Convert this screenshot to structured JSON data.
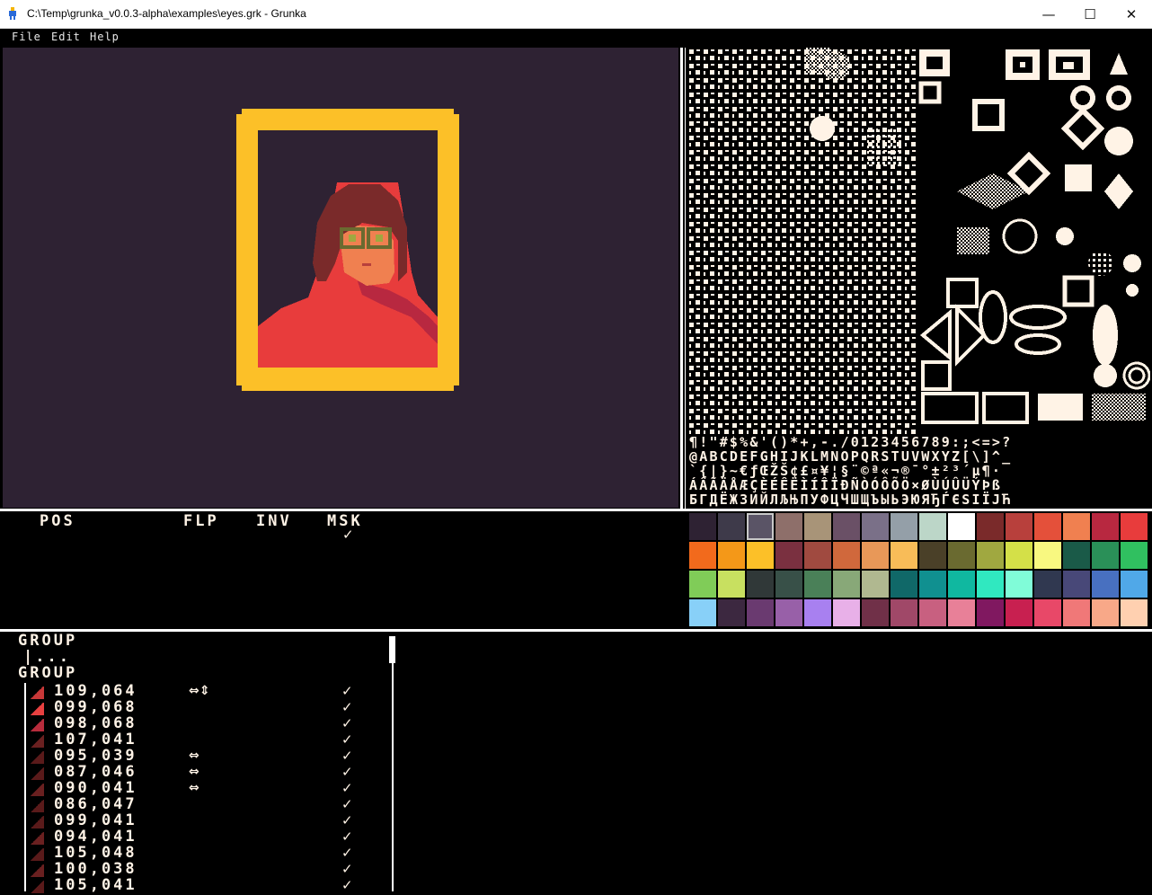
{
  "window": {
    "title": "C:\\Temp\\grunka_v0.0.3-alpha\\examples\\eyes.grk - Grunka",
    "minimize": "—",
    "maximize": "☐",
    "close": "✕"
  },
  "menu": [
    "File",
    "Edit",
    "Help"
  ],
  "glyphsheet": {
    "row1": "¶!\"#$%&'()*+,-./0123456789:;<=>?",
    "row2": "@ABCDEFGHIJKLMNOPQRSTUVWXYZ[\\]^_",
    "row3": "`{|}~€ƒŒŽŠ¢£¤¥¦§¨©ª«¬®¯°±²³´µ¶·",
    "row4": "ÁÂÃÄÅÆÇÈÉÊËÌÍÎÏÐÑÒÓÔÕÖ×ØÙÚÛÜÝÞß",
    "row5": "БГДЁЖЗИЙЛЉЊПУФЦЧШЩЪЫЬЭЮЯЂЃЄЅІЇЈЋ"
  },
  "properties": {
    "headers": {
      "pos": "POS",
      "flp": "FLP",
      "inv": "INV",
      "msk": "MSK"
    },
    "msk_value": "✓"
  },
  "palette": {
    "selected_index": 2,
    "colors": [
      "#2e2233",
      "#3e3a4a",
      "#5a5466",
      "#8e6f6a",
      "#a89478",
      "#6a5066",
      "#7a7088",
      "#949fa8",
      "#bcd6c8",
      "#ffffff",
      "#7a2a2a",
      "#b8403c",
      "#e4503a",
      "#f08050",
      "#b82840",
      "#e83c3c",
      "#f26a1c",
      "#f49818",
      "#fcc028",
      "#7a3040",
      "#a04a40",
      "#d0683c",
      "#e89858",
      "#f8bc58",
      "#4a4028",
      "#6a6a30",
      "#a0a840",
      "#d4e048",
      "#f8f880",
      "#1a5a48",
      "#2a9058",
      "#30c060",
      "#80cc58",
      "#c8e060",
      "#303838",
      "#385048",
      "#4a8058",
      "#88a878",
      "#b0b890",
      "#106868",
      "#109090",
      "#10b8a0",
      "#30e8c0",
      "#80fcd8",
      "#303850",
      "#484878",
      "#4870c0",
      "#50a8e8",
      "#88d0f8",
      "#3c2840",
      "#6a3a70",
      "#9860a8",
      "#a880f0",
      "#e8b0e8",
      "#703048",
      "#a04868",
      "#c86080",
      "#e88098",
      "#801860",
      "#c82050",
      "#e84868",
      "#f07878",
      "#f8a888",
      "#ffd0b0"
    ]
  },
  "layers": {
    "group1": "GROUP",
    "group1_child": "|...",
    "group2": "GROUP",
    "rows": [
      {
        "pos": "109,064",
        "flip": "⇔⇕",
        "msk": "✓",
        "thumb": "#c83838"
      },
      {
        "pos": "099,068",
        "flip": "",
        "msk": "✓",
        "thumb": "#e84040"
      },
      {
        "pos": "098,068",
        "flip": "",
        "msk": "✓",
        "thumb": "#b82c3c"
      },
      {
        "pos": "107,041",
        "flip": "",
        "msk": "✓",
        "thumb": "#6a2020"
      },
      {
        "pos": "095,039",
        "flip": "⇔",
        "msk": "✓",
        "thumb": "#5a1a1a"
      },
      {
        "pos": "087,046",
        "flip": "⇔",
        "msk": "✓",
        "thumb": "#5a1a1a"
      },
      {
        "pos": "090,041",
        "flip": "⇔",
        "msk": "✓",
        "thumb": "#6a2020"
      },
      {
        "pos": "086,047",
        "flip": "",
        "msk": "✓",
        "thumb": "#5a1a1a"
      },
      {
        "pos": "099,041",
        "flip": "",
        "msk": "✓",
        "thumb": "#5a1a1a"
      },
      {
        "pos": "094,041",
        "flip": "",
        "msk": "✓",
        "thumb": "#6a2020"
      },
      {
        "pos": "105,048",
        "flip": "",
        "msk": "✓",
        "thumb": "#5a1a1a"
      },
      {
        "pos": "100,038",
        "flip": "",
        "msk": "✓",
        "thumb": "#6a2020"
      },
      {
        "pos": "105,041",
        "flip": "",
        "msk": "✓",
        "thumb": "#5a1a1a"
      }
    ]
  }
}
